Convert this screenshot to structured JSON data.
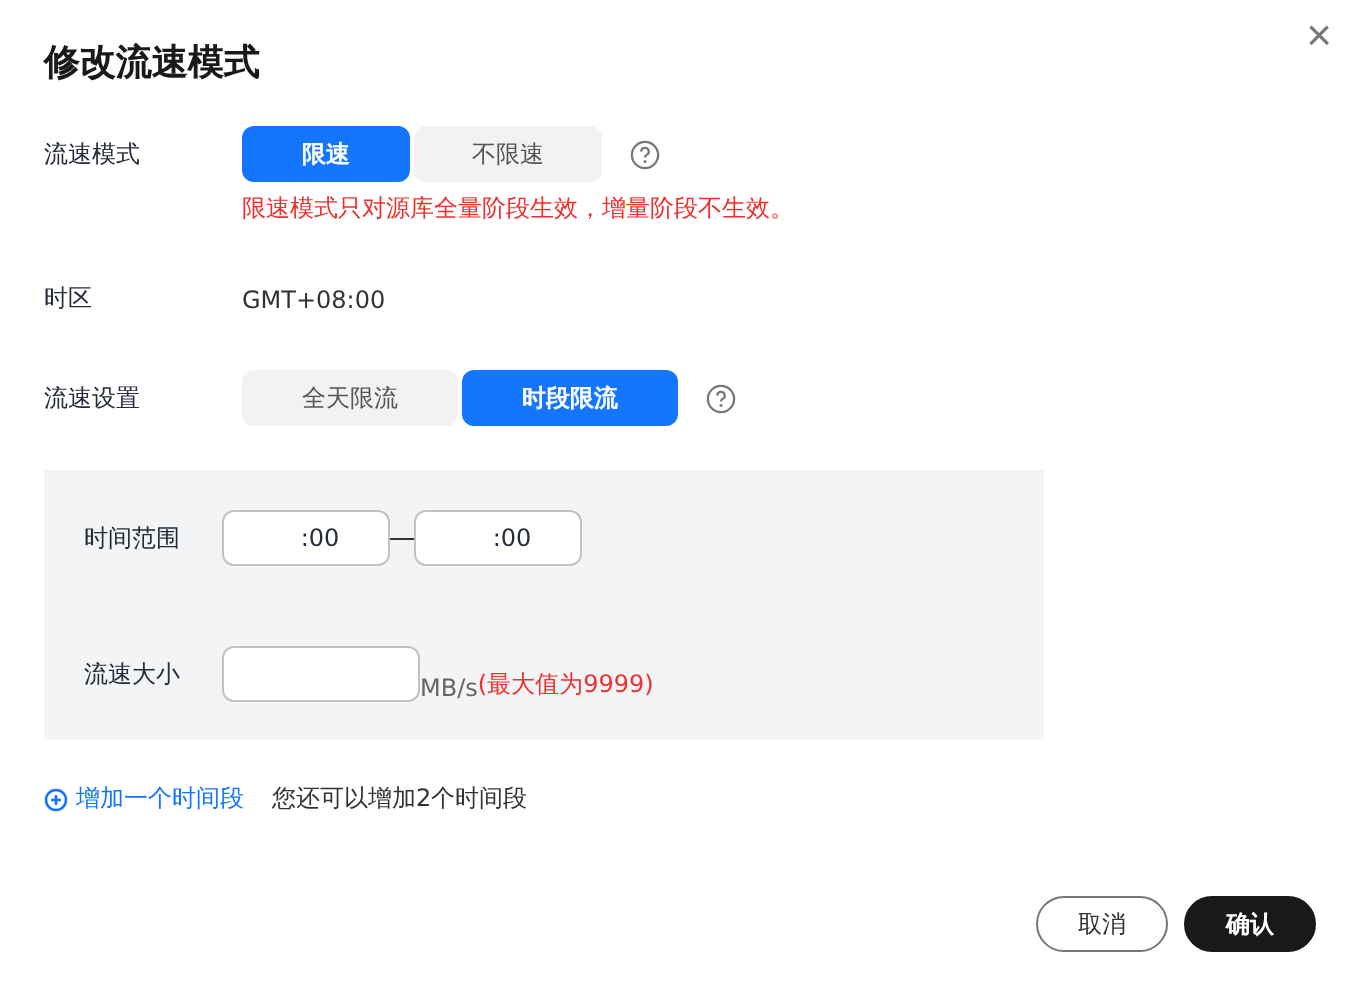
{
  "dialog": {
    "title": "修改流速模式",
    "close": "×"
  },
  "mode": {
    "label": "流速模式",
    "options": [
      {
        "label": "限速",
        "selected": true
      },
      {
        "label": "不限速",
        "selected": false
      }
    ],
    "warning": "限速模式只对源库全量阶段生效，增量阶段不生效。"
  },
  "timezone": {
    "label": "时区",
    "value": "GMT+08:00"
  },
  "setting": {
    "label": "流速设置",
    "options": [
      {
        "label": "全天限流",
        "selected": false
      },
      {
        "label": "时段限流",
        "selected": true
      }
    ]
  },
  "period": {
    "time_label": "时间范围",
    "start_suffix": ":00",
    "end_suffix": ":00",
    "speed_label": "流速大小",
    "unit": "MB/s",
    "max_hint": "(最大值为9999)"
  },
  "add": {
    "link": "增加一个时间段",
    "hint": "您还可以增加2个时间段"
  },
  "buttons": [
    {
      "label": "取消",
      "kind": "secondary"
    },
    {
      "label": "确认",
      "kind": "primary"
    }
  ]
}
